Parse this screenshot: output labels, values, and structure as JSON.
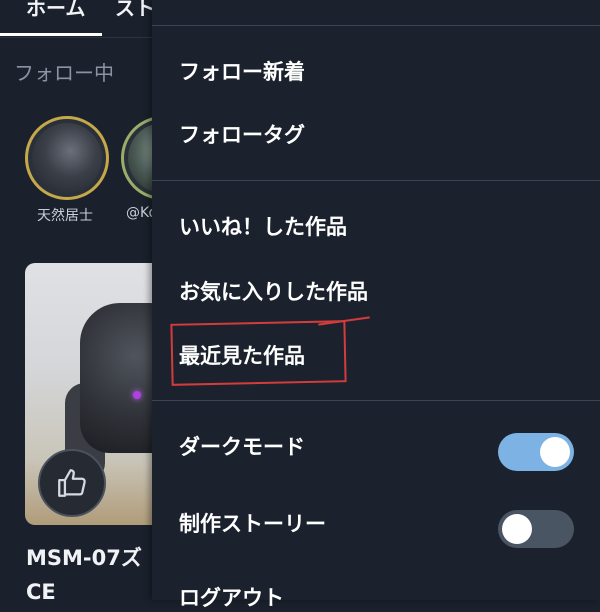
{
  "background": {
    "tabs": [
      "ホーム",
      "スト"
    ],
    "subtabs": {
      "following": "フォロー中",
      "other": ""
    },
    "avatars": [
      {
        "name": "天然居士"
      },
      {
        "name": "@Ko"
      }
    ],
    "card": {
      "title_line1": "MSM-07ズ",
      "title_line2": "CE"
    }
  },
  "menu": {
    "section1": [
      "フォロー新着",
      "フォロータグ"
    ],
    "section2": [
      "いいね！した作品",
      "お気に入りした作品",
      "最近見た作品"
    ],
    "settings": [
      {
        "label": "ダークモード",
        "enabled": true
      },
      {
        "label": "制作ストーリー",
        "enabled": false
      }
    ],
    "logout": "ログアウト"
  },
  "colors": {
    "menu_bg": "#1b222e",
    "toggle_on": "#7cb3e4",
    "toggle_off": "#4a5564",
    "annotation": "#d43c3c"
  }
}
